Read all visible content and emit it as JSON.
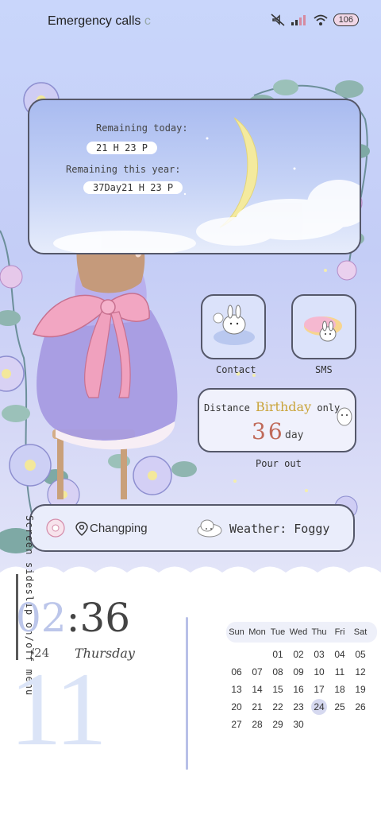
{
  "status_bar": {
    "carrier": "Emergency calls",
    "carrier_fade": "c",
    "battery": "106",
    "icons": [
      "mute-icon",
      "signal-icon",
      "wifi-icon",
      "battery-icon"
    ]
  },
  "countdown_widget": {
    "today_label": "Remaining today:",
    "today_value": "21 H 23 P",
    "year_label": "Remaining this year:",
    "year_value": "37Day21 H 23 P"
  },
  "apps": [
    {
      "label": "Contact",
      "icon": "bunny-cloud-icon"
    },
    {
      "label": "SMS",
      "icon": "bunny-cushion-icon"
    }
  ],
  "birthday_widget": {
    "prefix": "Distance",
    "highlight": "Birthday",
    "suffix": "only",
    "days": "36",
    "unit": "day"
  },
  "pour_out": "Pour out",
  "info_bar": {
    "location": "Changping",
    "weather": "Weather: Foggy"
  },
  "side_menu": "Screen sideslip on/off menu",
  "clock": {
    "hour": "02",
    "minute": ":36",
    "date": "/24",
    "weekday": "Thursday",
    "big_day": "11"
  },
  "calendar": {
    "weekdays": [
      "Sun",
      "Mon",
      "Tue",
      "Wed",
      "Thu",
      "Fri",
      "Sat"
    ],
    "days": [
      "",
      "",
      "01",
      "02",
      "03",
      "04",
      "05",
      "06",
      "07",
      "08",
      "09",
      "10",
      "11",
      "12",
      "13",
      "14",
      "15",
      "16",
      "17",
      "18",
      "19",
      "20",
      "21",
      "22",
      "23",
      "24",
      "25",
      "26",
      "27",
      "28",
      "29",
      "30",
      "",
      "",
      ""
    ],
    "today": "24"
  },
  "colors": {
    "frame": "#55586a",
    "highlight_gold": "#c9a43a",
    "days_red": "#c06a5a",
    "calendar_today": "#d6d9f0"
  }
}
